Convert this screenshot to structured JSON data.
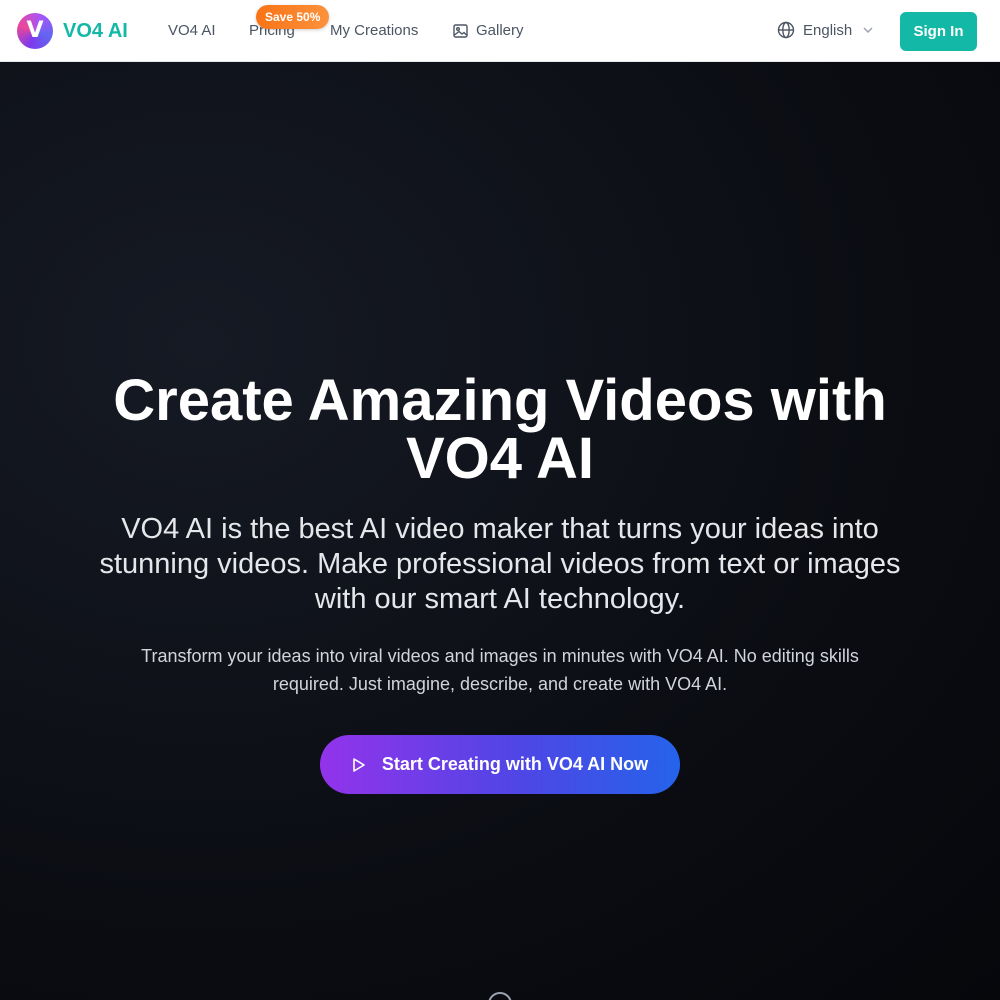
{
  "header": {
    "logo_letter": "V",
    "logo_text": "VO4 AI",
    "nav": {
      "vo4": "VO4 AI",
      "pricing": "Pricing",
      "pricing_badge": "Save 50%",
      "creations": "My Creations",
      "gallery": "Gallery"
    },
    "language": "English",
    "signin_label": "Sign In"
  },
  "hero": {
    "title_line1": "Create Amazing Videos with",
    "title_line2": "VO4 AI",
    "subtitle": "VO4 AI is the best AI video maker that turns your ideas into stunning videos. Make professional videos from text or images with our smart AI technology.",
    "description": "Transform your ideas into viral videos and images in minutes with VO4 AI. No editing skills required. Just imagine, describe, and create with VO4 AI.",
    "cta_label": "Start Creating with VO4 AI Now"
  },
  "icons": {
    "gallery": "image-icon",
    "language": "globe-icon",
    "language_dropdown": "chevron-down-icon",
    "cta": "play-icon"
  },
  "colors": {
    "brand": "#14b8a6",
    "badge": "#f97316",
    "cta_start": "#9333ea",
    "cta_end": "#2563eb",
    "hero_bg": "#0b0d13"
  }
}
